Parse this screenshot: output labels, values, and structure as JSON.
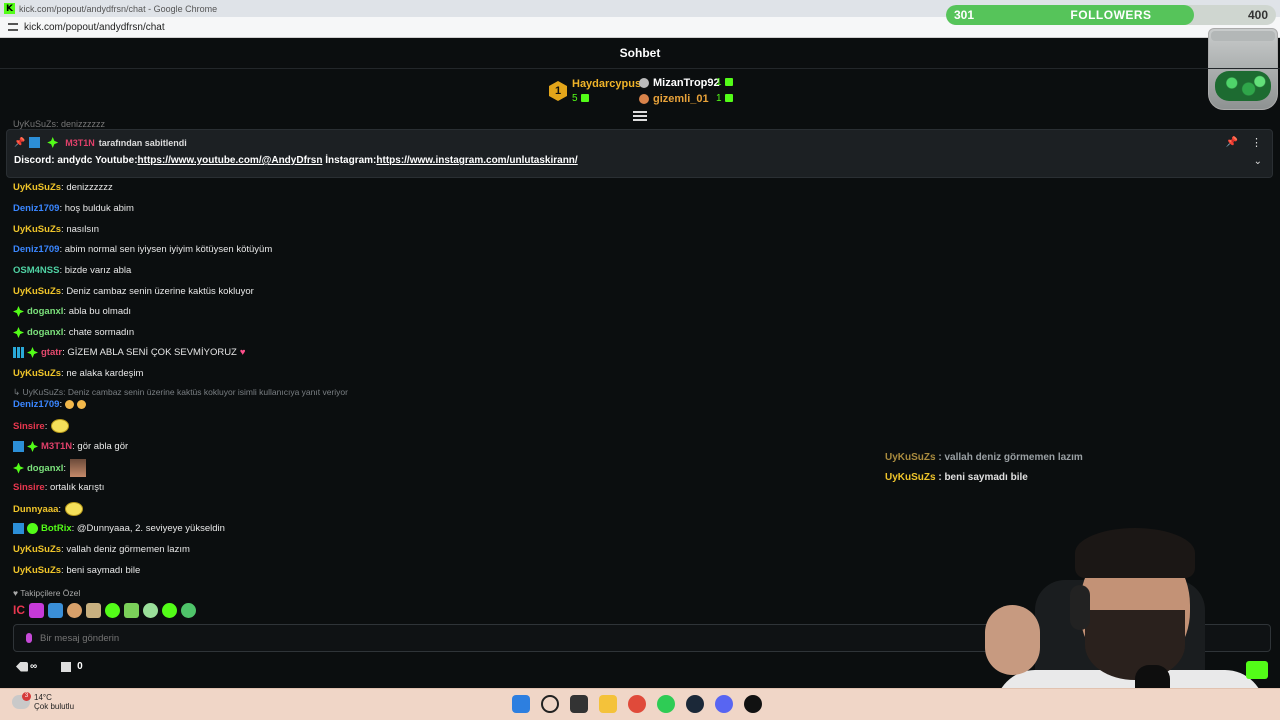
{
  "browser": {
    "title": "kick.com/popout/andydfrsn/chat - Google Chrome",
    "url": "kick.com/popout/andydfrsn/chat"
  },
  "followers_goal": {
    "current": "301",
    "label": "FOLLOWERS",
    "goal": "400",
    "progress_fraction": 0.7525,
    "color": "#56c45a"
  },
  "chat_header": {
    "title": "Sohbet"
  },
  "leaderboard": {
    "first": {
      "rank": "1",
      "name": "Haydarcypus",
      "count": "5"
    },
    "second": {
      "name": "MizanTrop92",
      "count": "1"
    },
    "third": {
      "name": "gizemli_01",
      "count": "1"
    }
  },
  "cut_message": "UyKuSuZs: denizzzzzz",
  "pinned": {
    "pinned_by_user": "M3T1N",
    "pinned_by_text": "tarafından sabitlendi",
    "prefix": "Discord: andydc Youtube:",
    "youtube_link": "https://www.youtube.com/@AndyDfrsn",
    "instagram_label": " İnstagram:",
    "instagram_link": "https://www.instagram.com/unlutaskirann/"
  },
  "messages": [
    {
      "user": "UyKuSuZs",
      "text": ": denizzzzzz"
    },
    {
      "user": "Deniz1709",
      "text": ": hoş bulduk abim"
    },
    {
      "user": "UyKuSuZs",
      "text": ": nasılsın"
    },
    {
      "user": "Deniz1709",
      "text": ": abim normal sen iyiysen iyiyim kötüysen kötüyüm"
    },
    {
      "user": "OSM4NSS",
      "text": ": bizde varız abla"
    },
    {
      "user": "UyKuSuZs",
      "text": ": Deniz cambaz senin üzerine kaktüs kokluyor"
    },
    {
      "user": "doganxl",
      "text": ": abla bu olmadı"
    },
    {
      "user": "doganxl",
      "text": ": chate sormadın"
    },
    {
      "user": "gtatr",
      "text": ": GİZEM ABLA SENİ ÇOK SEVMİYORUZ"
    },
    {
      "user": "UyKuSuZs",
      "text": ": ne alaka kardeşim"
    },
    {
      "user": "Deniz1709",
      "text": ":"
    },
    {
      "user": "Sinsire",
      "text": ":"
    },
    {
      "user": "M3T1N",
      "text": ": gör abla gör"
    },
    {
      "user": "doganxl",
      "text": ":"
    },
    {
      "user": "Sinsire",
      "text": ": ortalık karıştı"
    },
    {
      "user": "Dunnyaaa",
      "text": ":"
    },
    {
      "user": "BotRix",
      "text": ": @Dunnyaaa, 2. seviyeye yükseldin"
    },
    {
      "user": "UyKuSuZs",
      "text": ": vallah deniz görmemen lazım"
    },
    {
      "user": "UyKuSuZs",
      "text": ": beni saymadı bile"
    }
  ],
  "reply_context": "UyKuSuZs: Deniz cambaz senin üzerine kaktüs kokluyor isimli kullanıcıya yanıt veriyor",
  "followers_only_label": "Takipçilere Özel",
  "emote_bar_ic": "IC",
  "input": {
    "placeholder": "Bir mesaj gönderin"
  },
  "bottom_bar": {
    "points": "∞",
    "store_count": "0"
  },
  "overlay_chat": [
    {
      "user": "UyKuSuZs",
      "text": " : vallah deniz görmemen lazım"
    },
    {
      "user": "UyKuSuZs",
      "text": " : beni saymadı bile"
    }
  ],
  "taskbar": {
    "weather_temp": "14°C",
    "weather_desc": "Çok bulutlu",
    "weather_badge": "3"
  },
  "colors": {
    "kick_green": "#53fc18",
    "background": "#0b0e0f"
  }
}
